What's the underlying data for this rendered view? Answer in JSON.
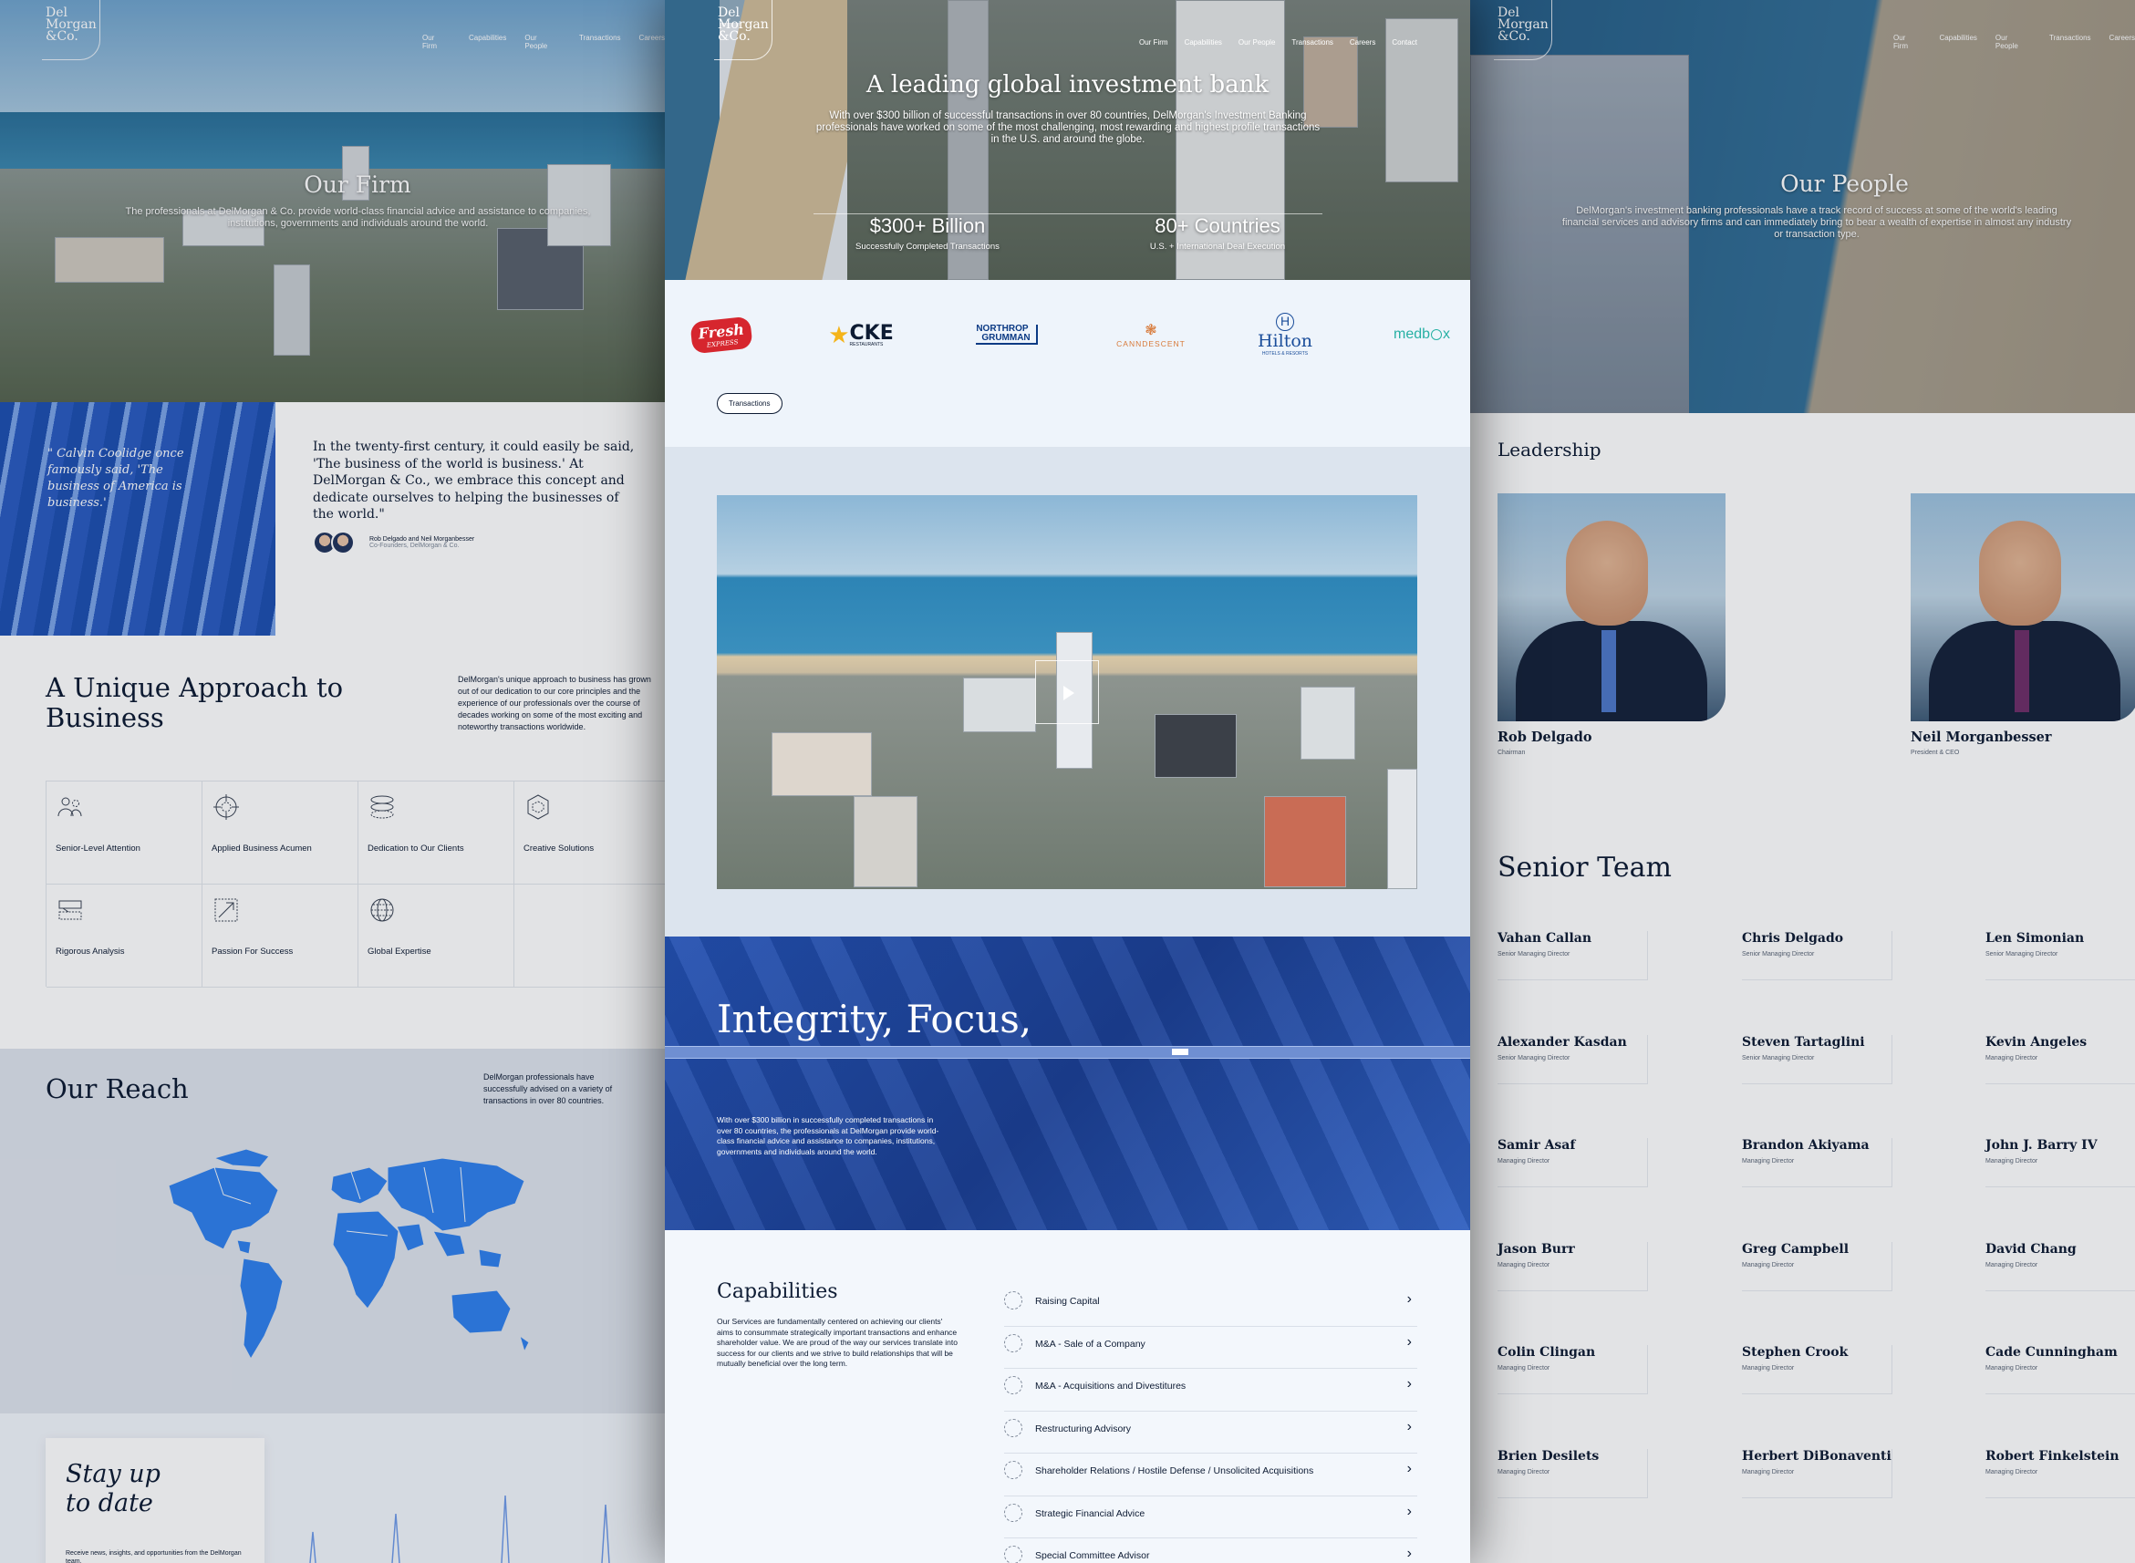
{
  "left": {
    "logo": [
      "Del",
      "Morgan",
      "&Co."
    ],
    "nav": [
      "Our Firm",
      "Capabilities",
      "Our People",
      "Transactions",
      "Careers"
    ],
    "hero_title": "Our Firm",
    "hero_sub": "The professionals at DelMorgan & Co. provide world-class financial advice and assistance to companies, institutions, governments and individuals around the world.",
    "quote": "\" Calvin Coolidge once famously said, 'The business of America is business.'",
    "quote_body": "In the twenty-first century, it could easily be said, 'The business of the world is business.' At DelMorgan & Co., we embrace this concept and dedicate ourselves to helping the businesses of the world.\"",
    "founders_name": "Rob Delgado and Neil Morganbesser",
    "founders_role": "Co-Founders, DelMorgan & Co.",
    "approach_title": "A Unique Approach to Business",
    "approach_body": "DelMorgan's unique approach to business has grown out of our dedication to our core principles and the experience of our professionals over the course of decades working on some of the most exciting and noteworthy transactions worldwide.",
    "features": [
      {
        "label": "Senior-Level Attention",
        "icon": "people-icon"
      },
      {
        "label": "Applied Business Acumen",
        "icon": "target-icon"
      },
      {
        "label": "Dedication to Our Clients",
        "icon": "layers-icon"
      },
      {
        "label": "Creative Solutions",
        "icon": "hexagon-icon"
      },
      {
        "label": "Rigorous Analysis",
        "icon": "analysis-icon"
      },
      {
        "label": "Passion For Success",
        "icon": "growth-icon"
      },
      {
        "label": "Global Expertise",
        "icon": "globe-icon"
      }
    ],
    "reach_title": "Our Reach",
    "reach_body": "DelMorgan professionals have successfully advised on a variety of transactions in over 80 countries.",
    "stay_title": [
      "Stay up",
      "to date"
    ],
    "stay_body": "Receive news, insights, and opportunities from the DelMorgan team."
  },
  "center": {
    "logo": [
      "Del",
      "Morgan",
      "&Co."
    ],
    "nav": [
      "Our Firm",
      "Capabilities",
      "Our People",
      "Transactions",
      "Careers",
      "Contact"
    ],
    "hero_title": "A leading global investment bank",
    "hero_sub": "With over $300 billion of successful transactions in over 80 countries, DelMorgan's Investment Banking professionals have worked on some of the most challenging, most rewarding and highest profile transactions in the U.S. and around the globe.",
    "stats": [
      {
        "num": "$300+ Billion",
        "cap": "Successfully Completed Transactions"
      },
      {
        "num": "80+ Countries",
        "cap": "U.S. + International Deal Execution"
      }
    ],
    "clients": {
      "fresh": [
        "Fresh",
        "EXPRESS"
      ],
      "cke": [
        "CKE",
        "RESTAURANTS"
      ],
      "northrop": [
        "NORTHROP",
        "GRUMMAN"
      ],
      "canndescent": "CANNDESCENT",
      "hilton": [
        "Hilton",
        "HOTELS & RESORTS"
      ],
      "medbox": [
        "med",
        "b",
        "x"
      ]
    },
    "transactions_button": "Transactions",
    "integrity_title": "Integrity, Focus,",
    "integrity_body": "With over $300 billion in successfully completed transactions in over 80 countries, the professionals at DelMorgan provide world-class financial advice and assistance to companies, institutions, governments and individuals around the world.",
    "capabilities_title": "Capabilities",
    "capabilities_body": "Our Services are fundamentally centered on achieving our clients' aims to consummate strategically important transactions and enhance shareholder value. We are proud of the way our services translate into success for our clients and we strive to build relationships that will be mutually beneficial over the long term.",
    "capabilities": [
      "Raising Capital",
      "M&A - Sale of a Company",
      "M&A - Acquisitions and Divestitures",
      "Restructuring Advisory",
      "Shareholder Relations / Hostile Defense / Unsolicited Acquisitions",
      "Strategic Financial Advice",
      "Special Committee Advisor"
    ]
  },
  "right": {
    "logo": [
      "Del",
      "Morgan",
      "&Co."
    ],
    "nav": [
      "Our Firm",
      "Capabilities",
      "Our People",
      "Transactions",
      "Careers"
    ],
    "hero_title": "Our People",
    "hero_sub": "DelMorgan's investment banking professionals have a track record of success at some of the world's leading financial services and advisory firms and can immediately bring to bear a wealth of expertise in almost any industry or transaction type.",
    "leadership_title": "Leadership",
    "leaders": [
      {
        "name": "Rob Delgado",
        "role": "Chairman"
      },
      {
        "name": "Neil Morganbesser",
        "role": "President & CEO"
      }
    ],
    "senior_title": "Senior Team",
    "team": [
      {
        "name": "Vahan Callan",
        "role": "Senior Managing Director"
      },
      {
        "name": "Chris Delgado",
        "role": "Senior Managing Director"
      },
      {
        "name": "Len Simonian",
        "role": "Senior Managing Director"
      },
      {
        "name": "Alexander Kasdan",
        "role": "Senior Managing Director"
      },
      {
        "name": "Steven Tartaglini",
        "role": "Senior Managing Director"
      },
      {
        "name": "Kevin Angeles",
        "role": "Managing Director"
      },
      {
        "name": "Samir Asaf",
        "role": "Managing Director"
      },
      {
        "name": "Brandon Akiyama",
        "role": "Managing Director"
      },
      {
        "name": "John J. Barry IV",
        "role": "Managing Director"
      },
      {
        "name": "Jason Burr",
        "role": "Managing Director"
      },
      {
        "name": "Greg Campbell",
        "role": "Managing Director"
      },
      {
        "name": "David Chang",
        "role": "Managing Director"
      },
      {
        "name": "Colin Clingan",
        "role": "Managing Director"
      },
      {
        "name": "Stephen Crook",
        "role": "Managing Director"
      },
      {
        "name": "Cade Cunningham",
        "role": "Managing Director"
      },
      {
        "name": "Brien Desilets",
        "role": "Managing Director"
      },
      {
        "name": "Herbert DiBonaventi",
        "role": "Managing Director"
      },
      {
        "name": "Robert Finkelstein",
        "role": "Managing Director"
      }
    ]
  },
  "colors": {
    "brand_blue": "#2f6fe3",
    "navy": "#0d1b33",
    "map_blue": "#2f80ed"
  }
}
